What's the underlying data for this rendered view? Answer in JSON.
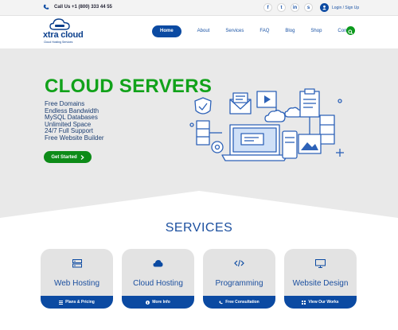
{
  "topbar": {
    "call": "Call Us +1 (800) 333 44 55",
    "socials": [
      {
        "icon": "facebook-icon",
        "glyph": "f"
      },
      {
        "icon": "twitter-icon",
        "glyph": "t"
      },
      {
        "icon": "linkedin-icon",
        "glyph": "in"
      },
      {
        "icon": "skype-icon",
        "glyph": "s"
      }
    ],
    "login": "Login / Sign Up"
  },
  "header": {
    "logo_text": "xtra cloud",
    "logo_tagline": "Cloud Hosting Services",
    "nav": [
      "Home",
      "About",
      "Services",
      "FAQ",
      "Blog",
      "Shop",
      "Contact"
    ],
    "active_nav": "Home"
  },
  "hero": {
    "title": "CLOUD SERVERS",
    "features": [
      "Free Domains",
      "Endless Bandwidth",
      "MySQL Databases",
      "Unlimited Space",
      "24/7 Full Support",
      "Free Website Builder"
    ],
    "cta": "Get Started"
  },
  "services": {
    "title": "SERVICES",
    "cards": [
      {
        "title": "Web Hosting",
        "icon": "server-icon",
        "footer": "Plans & Pricing",
        "footer_icon": "list-icon"
      },
      {
        "title": "Cloud Hosting",
        "icon": "cloud-icon",
        "footer": "More Info",
        "footer_icon": "info-icon"
      },
      {
        "title": "Programming",
        "icon": "code-icon",
        "footer": "Free Consultation",
        "footer_icon": "phone-icon"
      },
      {
        "title": "Website Design",
        "icon": "monitor-icon",
        "footer": "View Our Works",
        "footer_icon": "grid-icon"
      }
    ]
  },
  "colors": {
    "brand_blue": "#0b4aa2",
    "hero_green": "#11a21a",
    "hero_bg": "#e9e9e9"
  }
}
